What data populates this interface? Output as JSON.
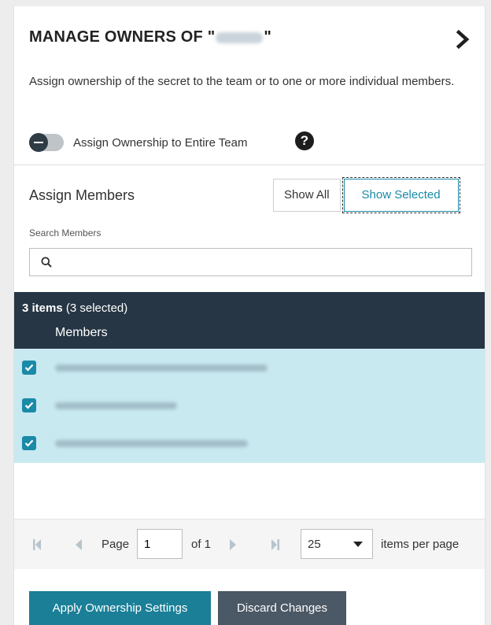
{
  "header": {
    "title_prefix": "MANAGE OWNERS OF \"",
    "title_suffix": "\"",
    "collapse_icon": "chevron-right-icon"
  },
  "description": "Assign ownership of the secret to the team or to one or more individual members.",
  "team_toggle": {
    "label": "Assign Ownership to Entire Team",
    "state": "off",
    "help_icon": "question-circle-icon",
    "help_glyph": "?"
  },
  "assign": {
    "title": "Assign Members",
    "show_all_label": "Show All",
    "show_selected_label": "Show Selected",
    "active_filter": "Show Selected"
  },
  "search": {
    "label": "Search Members",
    "value": "",
    "placeholder": "",
    "icon": "search-icon"
  },
  "table": {
    "count_bold": "3 items",
    "count_rest": "(3 selected)",
    "column_header": "Members",
    "rows": [
      {
        "checked": true,
        "label_redacted": true
      },
      {
        "checked": true,
        "label_redacted": true
      },
      {
        "checked": true,
        "label_redacted": true
      }
    ]
  },
  "pager": {
    "page_label": "Page",
    "page_value": "1",
    "of_label": "of 1",
    "items_per_page_value": "25",
    "items_per_page_label": "items per page"
  },
  "footer": {
    "apply_label": "Apply Ownership Settings",
    "discard_label": "Discard Changes"
  },
  "colors": {
    "accent": "#1a8aa8",
    "header_dark": "#263645",
    "row_selected": "#c8e9f0",
    "apply_button": "#1a7f97",
    "discard_button": "#4b5865"
  }
}
